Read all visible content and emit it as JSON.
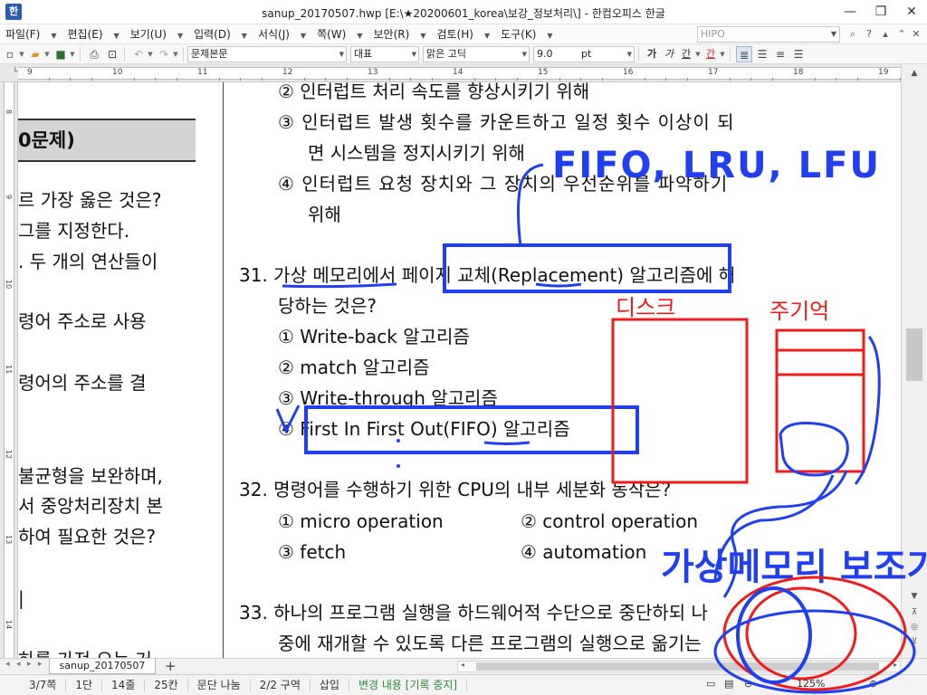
{
  "window": {
    "title": "sanup_20170507.hwp [E:\\★20200601_korea\\보강_정보처리\\] - 한컴오피스 한글",
    "app_icon": "한",
    "minimize": "—",
    "maximize": "❐",
    "close": "✕"
  },
  "menu": {
    "items": [
      {
        "label": "파일(F)"
      },
      {
        "label": "편집(E)"
      },
      {
        "label": "보기(U)"
      },
      {
        "label": "입력(D)"
      },
      {
        "label": "서식(J)"
      },
      {
        "label": "쪽(W)"
      },
      {
        "label": "보안(R)"
      },
      {
        "label": "검토(H)"
      },
      {
        "label": "도구(K)"
      }
    ],
    "search_placeholder": "HIPO"
  },
  "toolbar": {
    "style_combo": "문제본문",
    "lang_combo": "대표",
    "font_combo": "맑은 고딕",
    "size_combo": "9.0",
    "size_unit": "pt",
    "fmt_bold": "가",
    "fmt_italic": "가",
    "fmt_underline": "간",
    "fmt_color": "간"
  },
  "ruler": {
    "h_numbers": [
      "9",
      "10",
      "11",
      "12",
      "13",
      "14",
      "15",
      "16",
      "17",
      "18",
      "19"
    ],
    "v_numbers": [
      "8",
      "9",
      "10",
      "11",
      "12",
      "13",
      "14"
    ]
  },
  "document": {
    "left_column": {
      "heading": "0문제)",
      "lines": [
        "르 가장 옳은 것은?",
        "그를 지정한다.",
        ". 두 개의 연산들이",
        "령어 주소로 사용",
        "령어의 주소를 결",
        "불균형을 보완하며,",
        "서 중앙처리장치 본",
        "하여 필요한 것은?",
        "|",
        "하를 가져 오는 거"
      ]
    },
    "right_column": {
      "q30_opt2": "② 인터럽트 처리 속도를 향상시키기 위해",
      "q30_opt3_line1": "③ 인터럽트 발생 횟수를 카운트하고 일정 횟수 이상이 되",
      "q30_opt3_line2": "면 시스템을 정지시키기 위해",
      "q30_opt4_line1": "④ 인터럽트 요청 장치와 그 장치의 우선순위를 파악하기",
      "q30_opt4_line2": "위해",
      "q31_line1_num": "31.",
      "q31_line1_a": "가상 메모리",
      "q31_line1_b": "에서 페이지",
      "q31_line1_c": "교체",
      "q31_line1_d": "(Replacement) 알고리즘에 해",
      "q31_line2": "당하는 것은?",
      "q31_opt1": "① Write-back 알고리즘",
      "q31_opt2": "② match 알고리즘",
      "q31_opt3": "③ Write-through 알고리즘",
      "q31_opt4_a": "④ First In First Out(",
      "q31_opt4_b": "FIFO",
      "q31_opt4_c": ") 알고리즘",
      "q32_line1": "32. 명령어를 수행하기 위한 CPU의 내부 세분화 동작은?",
      "q32_opt1": "① micro operation",
      "q32_opt2": "② control operation",
      "q32_opt3": "③ fetch",
      "q32_opt4": "④ automation",
      "q33_line1": "33. 하나의 프로그램 실행을 하드웨어적 수단으로 중단하되 나",
      "q33_line2": "중에 재개할 수 있도록 다른 프로그램의 실행으로 옮기는"
    }
  },
  "annotations": {
    "ink_top": "FIFO, LRU, LFU",
    "ink_left_box": "디스크",
    "ink_right_box": "주기억",
    "ink_bottom": "가상메모리 보조기억"
  },
  "tabs": {
    "doc_tab": "sanup_20170507",
    "add_tab": "+"
  },
  "status": {
    "page": "3/7쪽",
    "section": "1단",
    "line": "14줄",
    "col": "25칸",
    "break_mode": "문단 나눔",
    "zone": "2/2 구역",
    "insert_mode": "삽입",
    "track_changes": "변경 내용 [기록 중지]",
    "zoom": "125%"
  },
  "colors": {
    "ink_blue": "#1f3ff0",
    "ink_red": "#ef1b1b",
    "heading_bg": "#d4d4d4"
  }
}
